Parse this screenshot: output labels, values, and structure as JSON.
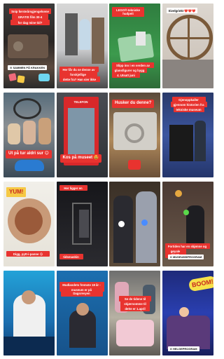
{
  "tiles": [
    {
      "stickers": [
        "Snip førsteårsgjengelsene",
        "GRATIS film 30-4",
        "for dag mine tid?"
      ],
      "footer": "⊙ SAMMEN PÅ KRAKKEN"
    },
    {
      "stickers": [
        "Her får du se denne av",
        "forskjellige kjoleinnkjøp",
        "dette fra? Han sier ikke"
      ]
    },
    {
      "stickers": [
        "LEGO®-tekniske hudpeit",
        "Slipp inn i en verden av",
        "glansfigurer og bygg",
        "4. Utsatt juni"
      ]
    },
    {
      "stickers": [
        "Sivelgriekt ❤️❤️❤️"
      ]
    },
    {
      "stickers": [
        "Ut på tur aldri sur 😊"
      ]
    },
    {
      "stickers": [
        "TELEFON",
        "Kos på museet 🤩"
      ]
    },
    {
      "stickers": [
        "Husker du denne?"
      ]
    },
    {
      "stickers": [
        "Gjenoppkaller",
        "gjennom historien fra",
        "tekniske museum"
      ]
    },
    {
      "stickers": [
        "YUM!",
        "Digg, pytt-i-panne 😋"
      ]
    },
    {
      "stickers": [
        "Her ligger en",
        "tidsmaskin"
      ]
    },
    {
      "stickers": []
    },
    {
      "stickers": [
        "Fortiden har en skjønne og",
        "gøyale ting?",
        "⊙ MUSEUMSPROGRAM"
      ]
    },
    {
      "stickers": []
    },
    {
      "stickers": [
        "Mudlandets fremste 18 år - Teknisk",
        "museum er på Dagsrevyen"
      ]
    },
    {
      "stickers": [
        "Se de tidene til",
        "skjærsomme til",
        "dette er 1.april"
      ]
    },
    {
      "stickers": [
        "BOOM!",
        "⊙ HELGEPROGRAM"
      ]
    }
  ]
}
